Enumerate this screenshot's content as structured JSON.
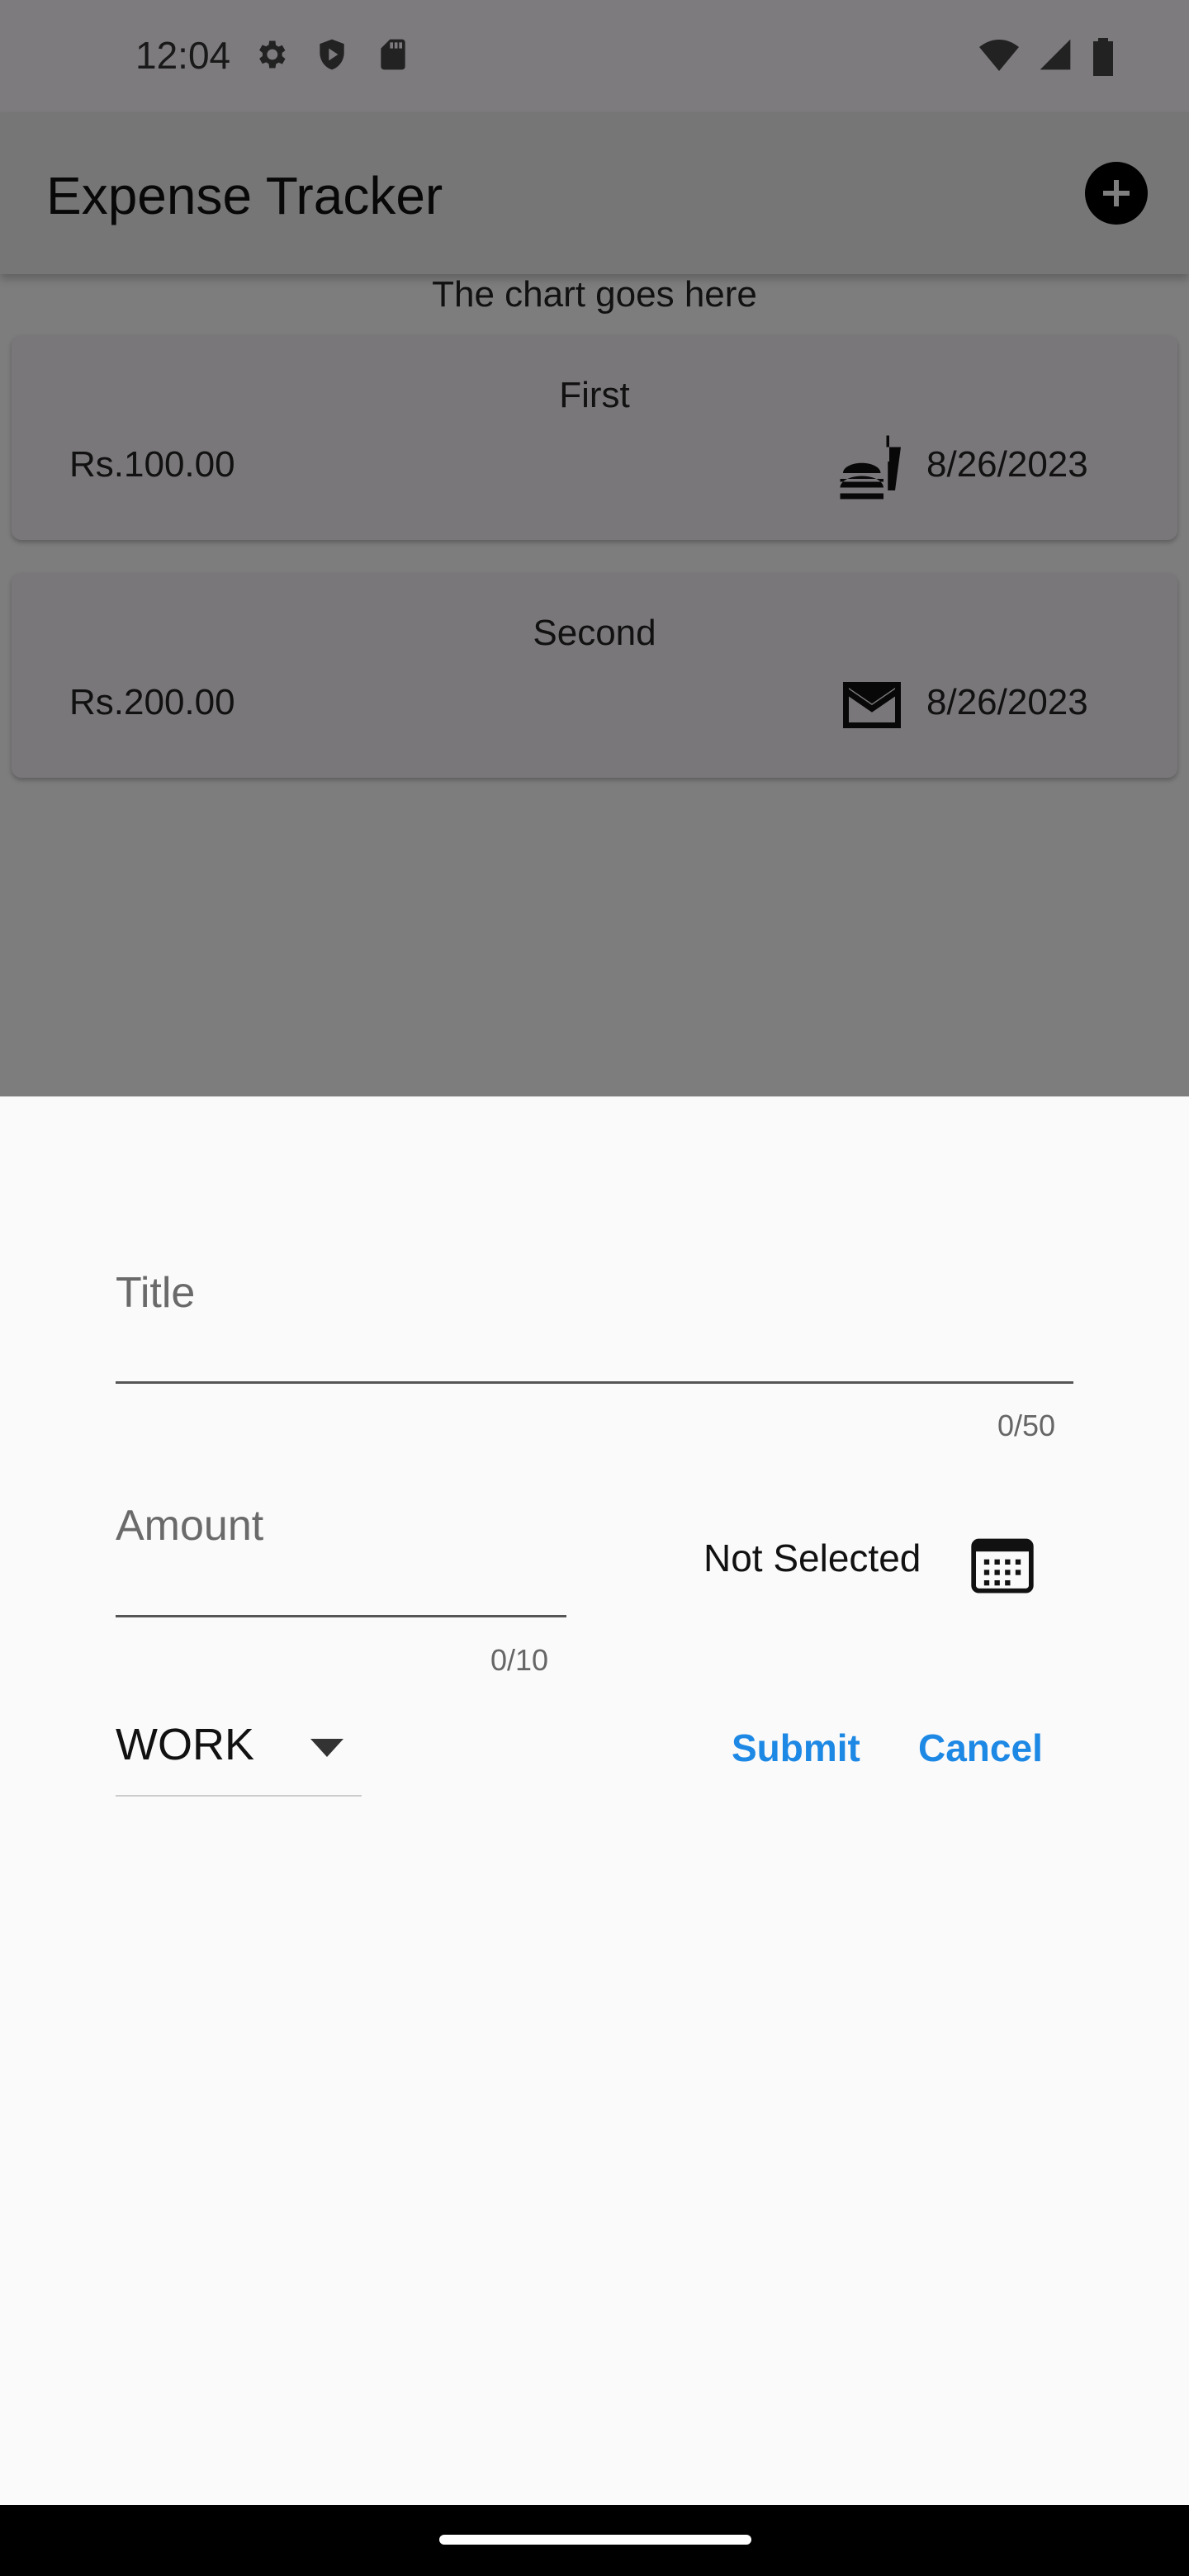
{
  "status_bar": {
    "time": "12:04",
    "icons_left": [
      "settings-icon",
      "shield-icon",
      "sd-card-icon"
    ],
    "icons_right": [
      "wifi-icon",
      "signal-icon",
      "battery-icon"
    ]
  },
  "app_bar": {
    "title": "Expense Tracker",
    "add_icon": "add-circle-icon"
  },
  "chart_placeholder": "The chart goes here",
  "expenses": [
    {
      "title": "First",
      "amount": "Rs.100.00",
      "icon": "fastfood-icon",
      "date": "8/26/2023"
    },
    {
      "title": "Second",
      "amount": "Rs.200.00",
      "icon": "mail-icon",
      "date": "8/26/2023"
    }
  ],
  "form": {
    "title_label": "Title",
    "title_counter": "0/50",
    "amount_label": "Amount",
    "amount_counter": "0/10",
    "date_text": "Not Selected",
    "date_icon": "calendar-icon",
    "category_value": "WORK",
    "submit_label": "Submit",
    "cancel_label": "Cancel"
  },
  "colors": {
    "accent": "#1e88e5",
    "scrim": "rgba(0,0,0,0.5)",
    "sheet_bg": "#fafafa"
  }
}
